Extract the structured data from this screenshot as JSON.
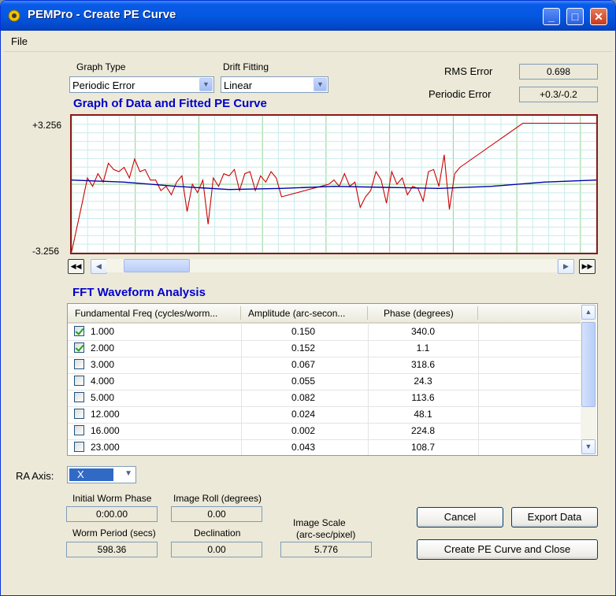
{
  "window": {
    "title": "PEMPro - Create PE Curve"
  },
  "menu": {
    "file": "File"
  },
  "graph_type": {
    "label": "Graph Type",
    "value": "Periodic Error"
  },
  "drift_fitting": {
    "label": "Drift Fitting",
    "value": "Linear"
  },
  "rms_error": {
    "label": "RMS Error",
    "value": "0.698"
  },
  "periodic_error": {
    "label": "Periodic Error",
    "value": "+0.3/-0.2"
  },
  "graph": {
    "title": "Graph of Data and Fitted PE Curve",
    "ymax_label": "+3.256",
    "ymin_label": "-3.256"
  },
  "chart_data": {
    "type": "line",
    "title": "Graph of Data and Fitted PE Curve",
    "ylim": [
      -3.256,
      3.256
    ],
    "grid": true,
    "series": [
      {
        "name": "",
        "color": "#cc0000",
        "x": [
          0,
          2,
          3,
          4,
          5,
          6,
          7,
          8,
          9,
          10,
          11,
          12,
          13,
          14,
          15,
          16,
          17,
          18,
          19,
          20,
          21,
          22,
          23,
          24,
          25,
          26,
          27,
          28,
          29,
          30,
          31,
          32,
          33,
          34,
          35,
          36,
          37,
          38,
          39,
          40,
          49,
          50,
          51,
          52,
          53,
          54,
          55,
          56,
          57,
          58,
          59,
          60,
          61,
          62,
          63,
          64,
          65,
          66,
          67,
          68,
          69,
          70,
          71,
          72,
          73,
          74,
          86,
          100
        ],
        "y": [
          -3.2,
          -0.9,
          0.3,
          -0.1,
          0.5,
          0.1,
          1.0,
          0.7,
          0.6,
          0.8,
          0.3,
          1.2,
          0.6,
          0.7,
          0.2,
          0.2,
          -0.3,
          -0.1,
          -0.5,
          0.1,
          0.4,
          -1.3,
          0.0,
          -0.4,
          0.2,
          -1.9,
          0.3,
          -0.1,
          0.5,
          0.4,
          0.7,
          -0.3,
          0.5,
          0.6,
          -0.3,
          0.4,
          0.1,
          0.6,
          0.3,
          -0.6,
          0.0,
          0.2,
          -0.1,
          0.5,
          -0.1,
          0.1,
          -1.1,
          -0.6,
          -0.3,
          0.6,
          0.2,
          -0.9,
          0.6,
          0.0,
          0.3,
          -0.5,
          -0.1,
          -0.2,
          -0.8,
          0.6,
          0.7,
          -0.1,
          1.4,
          -1.2,
          0.5,
          0.8,
          2.9,
          2.9
        ]
      },
      {
        "name": "",
        "color": "#0000aa",
        "x": [
          0,
          10,
          20,
          30,
          40,
          50,
          60,
          70,
          80,
          90,
          100
        ],
        "y": [
          0.2,
          0.1,
          -0.1,
          -0.25,
          -0.2,
          -0.1,
          -0.15,
          -0.2,
          -0.1,
          0.1,
          0.2
        ]
      }
    ]
  },
  "fft": {
    "title": "FFT Waveform Analysis",
    "columns": [
      "Fundamental Freq (cycles/worm...",
      "Amplitude (arc-secon...",
      "Phase (degrees)"
    ],
    "rows": [
      {
        "checked": true,
        "freq": "1.000",
        "amplitude": "0.150",
        "phase": "340.0"
      },
      {
        "checked": true,
        "freq": "2.000",
        "amplitude": "0.152",
        "phase": "1.1"
      },
      {
        "checked": false,
        "freq": "3.000",
        "amplitude": "0.067",
        "phase": "318.6"
      },
      {
        "checked": false,
        "freq": "4.000",
        "amplitude": "0.055",
        "phase": "24.3"
      },
      {
        "checked": false,
        "freq": "5.000",
        "amplitude": "0.082",
        "phase": "113.6"
      },
      {
        "checked": false,
        "freq": "12.000",
        "amplitude": "0.024",
        "phase": "48.1"
      },
      {
        "checked": false,
        "freq": "16.000",
        "amplitude": "0.002",
        "phase": "224.8"
      },
      {
        "checked": false,
        "freq": "23.000",
        "amplitude": "0.043",
        "phase": "108.7"
      }
    ]
  },
  "ra_axis": {
    "label": "RA Axis:",
    "value": "X"
  },
  "initial_worm_phase": {
    "label": "Initial Worm Phase",
    "value": "0:00.00"
  },
  "image_roll": {
    "label": "Image Roll (degrees)",
    "value": "0.00"
  },
  "worm_period": {
    "label": "Worm Period (secs)",
    "value": "598.36"
  },
  "declination": {
    "label": "Declination",
    "value": "0.00"
  },
  "image_scale": {
    "label1": "Image Scale",
    "label2": "(arc-sec/pixel)",
    "value": "5.776"
  },
  "buttons": {
    "cancel": "Cancel",
    "export": "Export Data",
    "create": "Create PE Curve and Close"
  }
}
